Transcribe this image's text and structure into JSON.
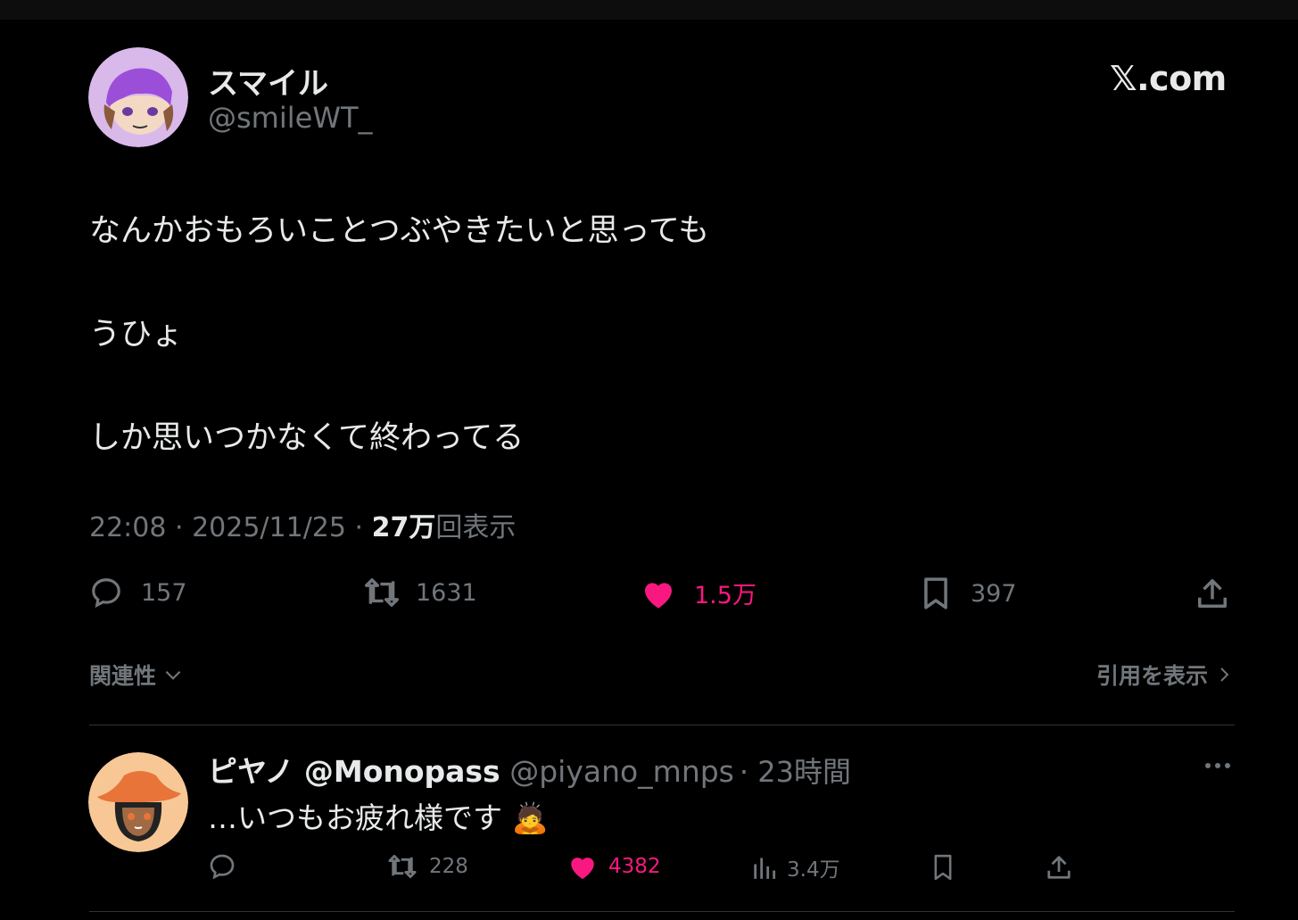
{
  "tweet": {
    "author": {
      "name": "スマイル",
      "handle": "@smileWT_"
    },
    "site_logo": "𝕏.com",
    "lines": [
      "なんかおもろいことつぶやきたいと思っても",
      "うひょ",
      "しか思いつかなくて終わってる"
    ],
    "timestamp": "22:08 · 2025/11/25 ·",
    "views_count": "27万",
    "views_label": "回表示",
    "stats": {
      "replies": "157",
      "reposts": "1631",
      "likes": "1.5万",
      "bookmarks": "397"
    },
    "icons": [
      "reply-icon",
      "repost-icon",
      "heart-icon",
      "bookmark-icon",
      "share-icon"
    ],
    "related_label": "関連性",
    "quotes_label": "引用を表示"
  },
  "reply": {
    "name": "ピヤノ @Monopass",
    "handle": "@piyano_mnps",
    "time": "· 23時間",
    "text": "…いつもお疲れ様です",
    "emoji": "🙇",
    "stats": {
      "replies": "",
      "reposts": "228",
      "likes": "4382",
      "views": "3.4万"
    }
  },
  "colors": {
    "background": "#000000",
    "text": "#e7e9ea",
    "secondary": "#71767b",
    "like": "#f91880",
    "divider": "#2f3336"
  }
}
